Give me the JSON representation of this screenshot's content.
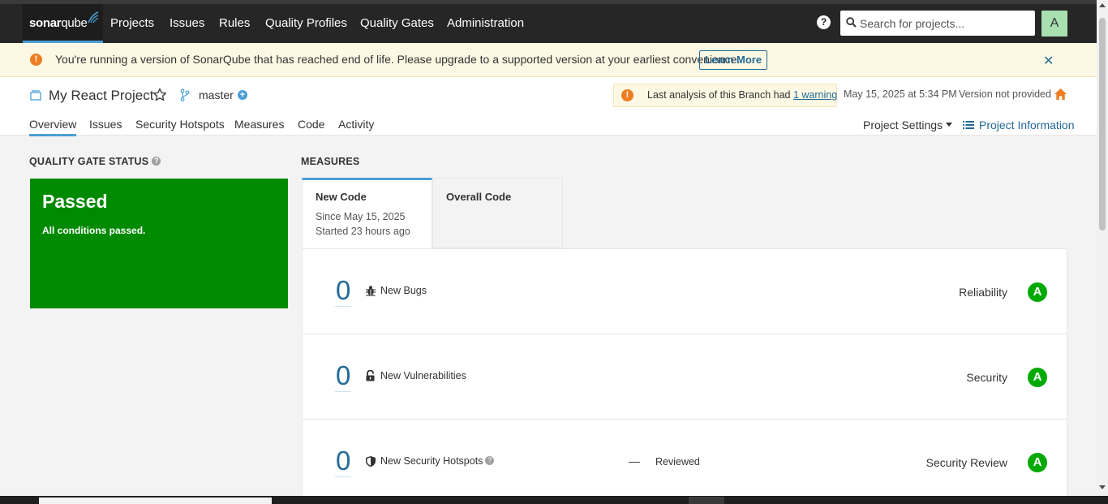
{
  "nav": {
    "logo": {
      "brand_bold": "sonar",
      "brand_light": "qube"
    },
    "items": [
      "Projects",
      "Issues",
      "Rules",
      "Quality Profiles",
      "Quality Gates",
      "Administration"
    ],
    "help_label": "?",
    "search_placeholder": "Search for projects...",
    "avatar_initial": "A"
  },
  "banner": {
    "message": "You're running a version of SonarQube that has reached end of life. Please upgrade to a supported version at your earliest convenience.",
    "learn_more": "Learn More",
    "close": "✕",
    "icon": "exclamation-icon"
  },
  "project": {
    "name": "My React Project",
    "branch": "master",
    "analysis_prefix": "Last analysis of this Branch had",
    "analysis_link": "1 warning",
    "analysis_date": "May 15, 2025 at 5:34 PM",
    "version": "Version not provided",
    "tabs": [
      "Overview",
      "Issues",
      "Security Hotspots",
      "Measures",
      "Code",
      "Activity"
    ],
    "active_tab": "Overview",
    "settings": "Project Settings",
    "info": "Project Information"
  },
  "quality_gate": {
    "section_title": "QUALITY GATE STATUS",
    "status": "Passed",
    "subtitle": "All conditions passed.",
    "color": "#008a00"
  },
  "measures": {
    "section_title": "MEASURES",
    "tabs": [
      {
        "title": "New Code",
        "line1": "Since May 15, 2025",
        "line2": "Started 23 hours ago"
      },
      {
        "title": "Overall Code"
      }
    ],
    "rows": [
      {
        "value": "0",
        "label": "New Bugs",
        "icon": "bug-icon",
        "category": "Reliability",
        "rating": "A"
      },
      {
        "value": "0",
        "label": "New Vulnerabilities",
        "icon": "lock-icon",
        "category": "Security",
        "rating": "A"
      },
      {
        "value": "0",
        "label": "New Security Hotspots",
        "icon": "shield-icon",
        "reviewed_value": "—",
        "reviewed_label": "Reviewed",
        "category": "Security Review",
        "rating": "A"
      }
    ],
    "rating_color": "#00aa00",
    "value_color": "#236a97"
  },
  "colors": {
    "topbar": "#262626",
    "accent": "#4b9fd5",
    "warning": "#ed7d20",
    "link": "#236a97"
  }
}
